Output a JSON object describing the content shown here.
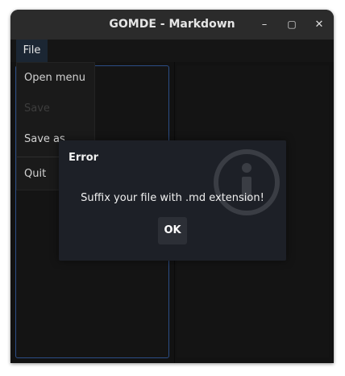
{
  "window": {
    "title": "GOMDE - Markdown",
    "controls": {
      "minimize": "–",
      "maximize": "▢",
      "close": "✕"
    }
  },
  "menubar": {
    "file_label": "File"
  },
  "file_menu": {
    "items": [
      {
        "label": "Open menu",
        "enabled": true
      },
      {
        "label": "Save",
        "enabled": false
      },
      {
        "label": "Save as",
        "enabled": true
      },
      {
        "label": "Quit",
        "enabled": true
      }
    ]
  },
  "dialog": {
    "title": "Error",
    "icon": "info-icon",
    "message": "Suffix your file with .md extension!",
    "ok_label": "OK"
  },
  "colors": {
    "window_bg": "#121212",
    "titlebar_bg": "#2b2b2b",
    "editor_border": "#2c4e86",
    "dialog_bg": "#1d2027",
    "menu_highlight": "#1b2633"
  }
}
